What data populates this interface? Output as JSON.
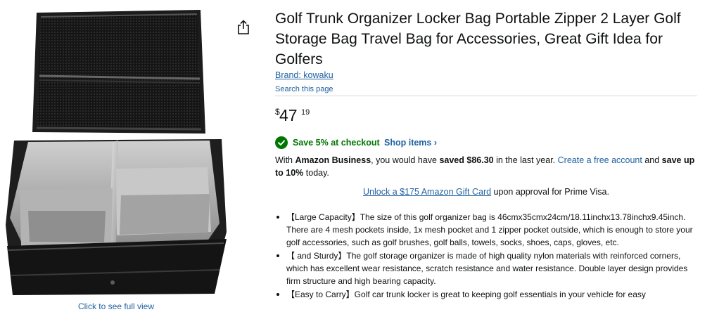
{
  "image_gallery": {
    "full_view_link": "Click to see full view"
  },
  "product": {
    "title": "Golf Trunk Organizer Locker Bag Portable Zipper 2 Layer Golf Storage Bag Travel Bag for Accessories, Great Gift Idea for Golfers",
    "brand_link": "Brand: kowaku",
    "search_page": "Search this page",
    "price": {
      "symbol": "$",
      "whole": "47",
      "fraction": "19"
    },
    "promo": {
      "text": "Save 5% at checkout",
      "shop_items": "Shop items ›"
    },
    "business": {
      "prefix": "With ",
      "brand": "Amazon Business",
      "mid": ", you would have ",
      "saved": "saved $86.30",
      "mid2": " in the last year. ",
      "link": "Create a free account",
      "mid3": " and ",
      "save_up": "save up to 10%",
      "suffix": " today."
    },
    "giftcard": {
      "link": "Unlock a $175 Amazon Gift Card",
      "suffix": " upon approval for Prime Visa."
    },
    "bullets": [
      "【Large Capacity】The size of this golf organizer bag is 46cmx35cmx24cm/18.11inchx13.78inchx9.45inch. There are 4 mesh pockets inside, 1x mesh pocket and 1 zipper pocket outside, which is enough to store your golf accessories, such as golf brushes, golf balls, towels, socks, shoes, caps, gloves, etc.",
      "【 and Sturdy】The golf storage organizer is made of high quality nylon materials with reinforced corners, which has excellent wear resistance, scratch resistance and water resistance. Double layer design provides firm structure and high bearing capacity.",
      "【Easy to Carry】Golf car trunk locker is great to keeping golf essentials in your vehicle for easy"
    ]
  },
  "colors": {
    "link": "#2162a1",
    "promo_green": "#007600",
    "text": "#0f1111"
  }
}
